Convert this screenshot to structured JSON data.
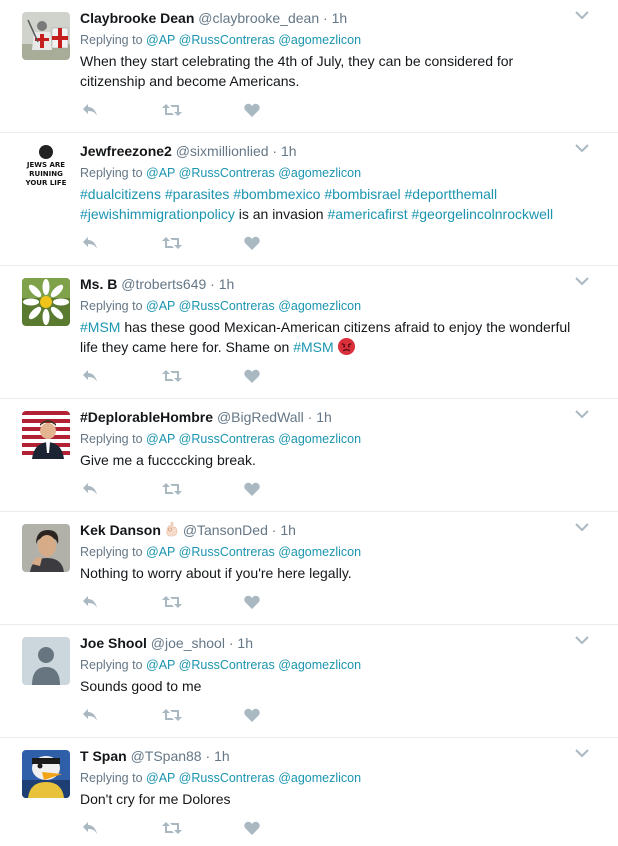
{
  "colors": {
    "link": "#1b95b0",
    "meta": "#657786",
    "icon": "#aab8c2",
    "divider": "#e6ecf0"
  },
  "tweets": [
    {
      "name": "Claybrooke Dean",
      "handle": "@claybrooke_dean",
      "dot": "·",
      "time": "1h",
      "replying_label": "Replying to",
      "mentions": [
        "@AP",
        "@RussContreras",
        "@agomezlicon"
      ],
      "text": "When they start celebrating the 4th of July, they can be considered for citizenship and become Americans.",
      "avatar_icon": "crusader-knight-avatar"
    },
    {
      "name": "Jewfreezone2",
      "handle": "@sixmillionlied",
      "dot": "·",
      "time": "1h",
      "replying_label": "Replying to",
      "mentions": [
        "@AP",
        "@RussContreras",
        "@agomezlicon"
      ],
      "text_parts": [
        "#dualcitizens",
        " ",
        "#parasites",
        " ",
        "#bombmexico",
        " ",
        "#bombisrael",
        " ",
        "#deportthemall",
        " ",
        "#jewishimmigrationpolicy",
        " is an invasion ",
        "#americafirst",
        " ",
        "#georgelincolnrockwell"
      ],
      "avatar_text": [
        "JEWS ARE",
        "RUINING",
        "YOUR LIFE"
      ]
    },
    {
      "name": "Ms. B",
      "handle": "@troberts649",
      "dot": "·",
      "time": "1h",
      "replying_label": "Replying to",
      "mentions": [
        "@AP",
        "@RussContreras",
        "@agomezlicon"
      ],
      "text_parts": [
        "#MSM",
        " has these good Mexican-American citizens afraid to enjoy the wonderful life they came here for. Shame on ",
        "#MSM"
      ],
      "emoji": "angry-face-emoji",
      "avatar_icon": "daisy-flower-avatar"
    },
    {
      "name": "#DeplorableHombre",
      "handle": "@BigRedWall",
      "dot": "·",
      "time": "1h",
      "replying_label": "Replying to",
      "mentions": [
        "@AP",
        "@RussContreras",
        "@agomezlicon"
      ],
      "text": "Give me a fuccccking break.",
      "avatar_icon": "flag-portrait-avatar"
    },
    {
      "name": "Kek Danson",
      "handle": "@TansonDed",
      "dot": "·",
      "time": "1h",
      "name_emoji": "ok-hand-emoji",
      "replying_label": "Replying to",
      "mentions": [
        "@AP",
        "@RussContreras",
        "@agomezlicon"
      ],
      "text": "Nothing to worry about if you're here legally.",
      "avatar_icon": "portrait-photo-avatar"
    },
    {
      "name": "Joe Shool",
      "handle": "@joe_shool",
      "dot": "·",
      "time": "1h",
      "replying_label": "Replying to",
      "mentions": [
        "@AP",
        "@RussContreras",
        "@agomezlicon"
      ],
      "text": "Sounds good to me",
      "avatar_icon": "default-user-avatar"
    },
    {
      "name": "T Span",
      "handle": "@TSpan88",
      "dot": "·",
      "time": "1h",
      "replying_label": "Replying to",
      "mentions": [
        "@AP",
        "@RussContreras",
        "@agomezlicon"
      ],
      "text": "Don't cry for me Dolores",
      "avatar_icon": "cartoon-duck-avatar"
    }
  ]
}
